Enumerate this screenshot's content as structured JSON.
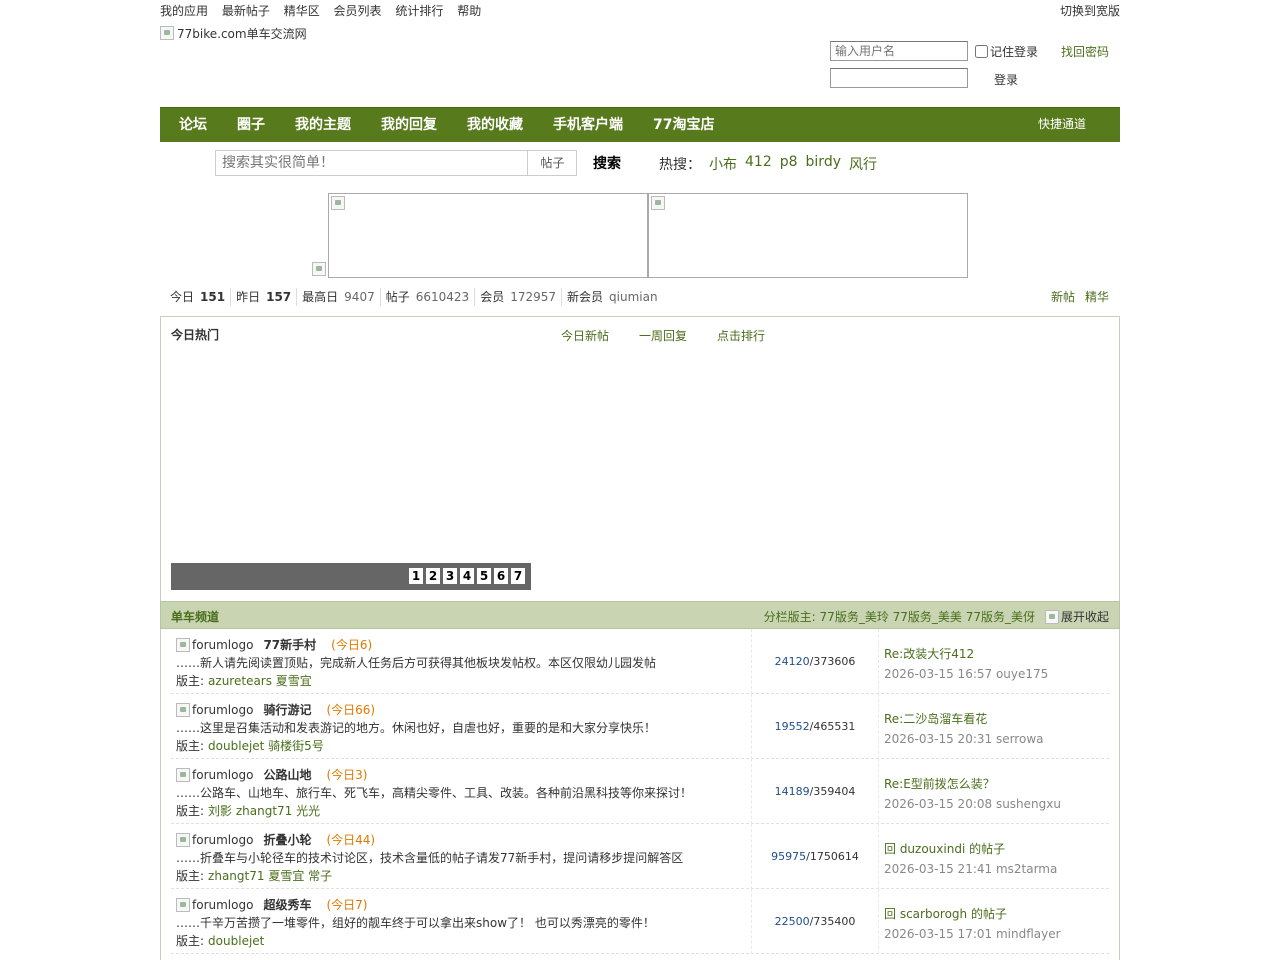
{
  "topbar": {
    "links": [
      "我的应用",
      "最新帖子",
      "精华区",
      "会员列表",
      "统计排行",
      "帮助"
    ],
    "switch_wide": "切换到宽版"
  },
  "header": {
    "logo_alt": "77bike.com单车交流网"
  },
  "login": {
    "username_placeholder": "输入用户名",
    "remember_label": "记住登录",
    "find_password": "找回密码",
    "login_button": "登录"
  },
  "nav": {
    "items": [
      "论坛",
      "圈子",
      "我的主题",
      "我的回复",
      "我的收藏",
      "手机客户端",
      "77淘宝店"
    ],
    "quick": "快捷通道"
  },
  "search": {
    "placeholder": "搜索其实很简单！",
    "scope": "帖子",
    "button": "搜索",
    "hot_label": "热搜：",
    "hot_keywords": [
      "小布",
      "412",
      "p8",
      "birdy",
      "风行"
    ]
  },
  "stats": {
    "today_label": "今日",
    "today": "151",
    "yesterday_label": "昨日",
    "yesterday": "157",
    "max_label": "最高日",
    "max": "9407",
    "posts_label": "帖子",
    "posts": "6610423",
    "members_label": "会员",
    "members": "172957",
    "newmember_label": "新会员",
    "newmember": "qiumian",
    "new_posts": "新帖",
    "digest": "精华"
  },
  "hot": {
    "title": "今日热门",
    "tabs": [
      "今日新帖",
      "一周回复",
      "点击排行"
    ],
    "pages": [
      "1",
      "2",
      "3",
      "4",
      "5",
      "6",
      "7"
    ]
  },
  "channel": {
    "name": "单车频道",
    "mods_label": "分栏版主:",
    "mods": "77版务_美玲 77版务_美美 77版务_美伢",
    "collapse": "展开收起"
  },
  "forums": [
    {
      "logo": "forumlogo",
      "name": "77新手村",
      "today": "(今日6)",
      "desc": "……新人请先阅读置顶贴，完成新人任务后方可获得其他板块发帖权。本区仅限幼儿园发帖",
      "mods_label": "版主:",
      "mods": "azuretears 夏雪宜",
      "topics": "24120",
      "posts": "/373606",
      "last_title": "Re:改装大行412",
      "last_meta": "2026-03-15 16:57 ouye175"
    },
    {
      "logo": "forumlogo",
      "name": "骑行游记",
      "today": "(今日66)",
      "desc": "……这里是召集活动和发表游记的地方。休闲也好，自虐也好，重要的是和大家分享快乐！",
      "mods_label": "版主:",
      "mods": "doublejet 骑楼街5号",
      "topics": "19552",
      "posts": "/465531",
      "last_title": "Re:二沙岛溜车看花",
      "last_meta": "2026-03-15 20:31 serrowa"
    },
    {
      "logo": "forumlogo",
      "name": "公路山地",
      "today": "(今日3)",
      "desc": "……公路车、山地车、旅行车、死飞车，高精尖零件、工具、改装。各种前沿黑科技等你来探讨！",
      "mods_label": "版主:",
      "mods": "刘影 zhangt71 光光",
      "topics": "14189",
      "posts": "/359404",
      "last_title": "Re:E型前拨怎么装？",
      "last_meta": "2026-03-15 20:08 sushengxu"
    },
    {
      "logo": "forumlogo",
      "name": "折叠小轮",
      "today": "(今日44)",
      "desc": "……折叠车与小轮径车的技术讨论区，技术含量低的帖子请发77新手村，提问请移步提问解答区",
      "mods_label": "版主:",
      "mods": "zhangt71 夏雪宜 常子",
      "topics": "95975",
      "posts": "/1750614",
      "last_title": "回 duzouxindi 的帖子",
      "last_meta": "2026-03-15 21:41 ms2tarma"
    },
    {
      "logo": "forumlogo",
      "name": "超级秀车",
      "today": "(今日7)",
      "desc": "……千辛万苦攒了一堆零件，组好的靓车终于可以拿出来show了！ 也可以秀漂亮的零件！",
      "mods_label": "版主:",
      "mods": "doublejet",
      "topics": "22500",
      "posts": "/735400",
      "last_title": "回 scarborogh 的帖子",
      "last_meta": "2026-03-15 17:01 mindflayer"
    }
  ]
}
